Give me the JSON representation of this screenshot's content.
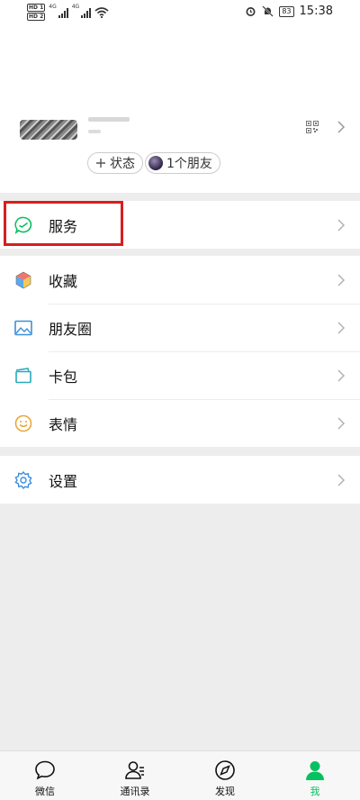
{
  "status_bar": {
    "time": "15:38",
    "battery": "83"
  },
  "profile": {
    "status_button": "状态",
    "friends_button": "1个朋友"
  },
  "menu": {
    "services": "服务",
    "favorites": "收藏",
    "moments": "朋友圈",
    "cards": "卡包",
    "stickers": "表情",
    "settings": "设置"
  },
  "tabbar": {
    "chats": "微信",
    "contacts": "通讯录",
    "discover": "发现",
    "me": "我"
  },
  "colors": {
    "accent": "#07c160",
    "highlight": "#d81e1e"
  }
}
